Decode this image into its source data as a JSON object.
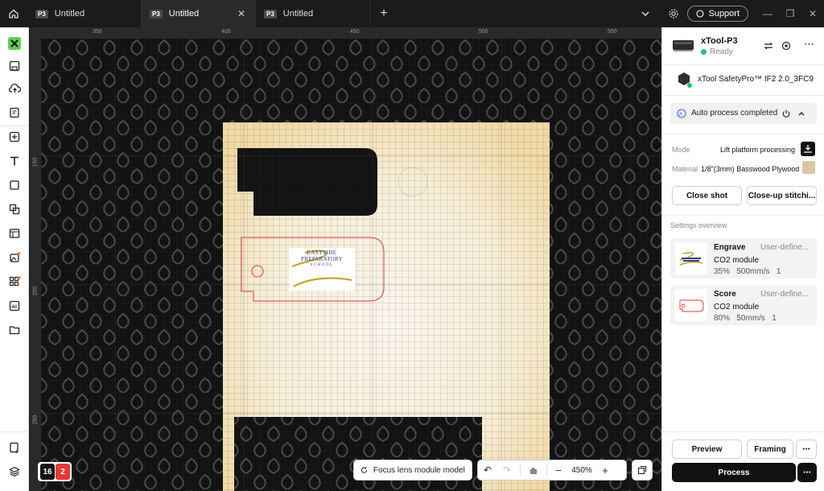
{
  "tabs": [
    {
      "badge": "P3",
      "label": "Untitled",
      "active": false
    },
    {
      "badge": "P3",
      "label": "Untitled",
      "active": true
    },
    {
      "badge": "P3",
      "label": "Untitled",
      "active": false
    }
  ],
  "titlebar": {
    "support_label": "Support"
  },
  "rulers": {
    "top": [
      "350",
      "400",
      "450",
      "500",
      "550"
    ],
    "left": [
      "150",
      "200",
      "250"
    ]
  },
  "canvas": {
    "logo_line1": "EASTSIDE",
    "logo_line2": "PREPARATORY",
    "logo_line3": "SCHOOL",
    "layer_count": "16",
    "warning_count": "2",
    "focus_label": "Focus lens module model: M",
    "zoom": "450%"
  },
  "device": {
    "name": "xTool-P3",
    "status": "Ready",
    "accessory": "xTool SafetyPro™ IF2 2.0_3FC9"
  },
  "auto_process": {
    "label": "Auto process completed"
  },
  "settings": {
    "mode_label": "Mode",
    "mode_value": "Lift platform processing",
    "material_label": "Material",
    "material_value": "1/8\"(3mm) Basswood Plywood",
    "close_shot": "Close shot",
    "closeup_stitch": "Close-up stitchi..."
  },
  "overview": {
    "title": "Settings overview",
    "items": [
      {
        "name": "Engrave",
        "type": "User-define...",
        "module": "CO2 module",
        "power": "35%",
        "speed": "500mm/s",
        "passes": "1"
      },
      {
        "name": "Score",
        "type": "User-define...",
        "module": "CO2 module",
        "power": "80%",
        "speed": "50mm/s",
        "passes": "1"
      }
    ]
  },
  "actions": {
    "preview": "Preview",
    "framing": "Framing",
    "process": "Process"
  },
  "colors": {
    "accent_green": "#22c55e",
    "warning_red": "#e53935",
    "material_swatch": "#dcc6a8"
  }
}
